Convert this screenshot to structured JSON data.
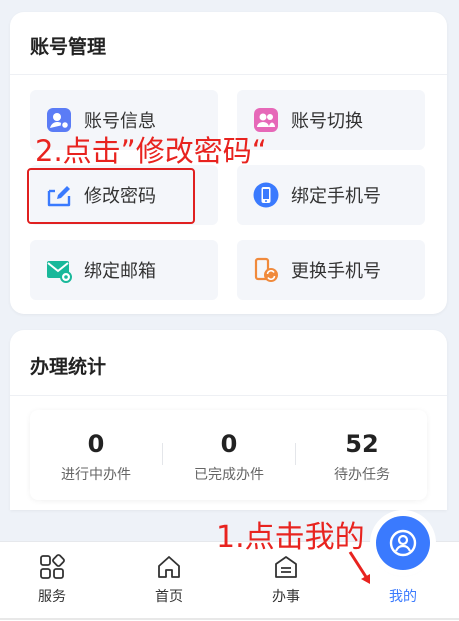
{
  "account_section": {
    "title": "账号管理",
    "items": [
      {
        "label": "账号信息",
        "icon": "user-info-icon",
        "color": "#5b7cf6"
      },
      {
        "label": "账号切换",
        "icon": "user-switch-icon",
        "color": "#e668b8"
      },
      {
        "label": "修改密码",
        "icon": "edit-password-icon",
        "color": "#3a7afe"
      },
      {
        "label": "绑定手机号",
        "icon": "bind-phone-icon",
        "color": "#3a7afe"
      },
      {
        "label": "绑定邮箱",
        "icon": "mail-icon",
        "color": "#19b89a"
      },
      {
        "label": "更换手机号",
        "icon": "change-phone-icon",
        "color": "#f08a3c"
      }
    ]
  },
  "stats_section": {
    "title": "办理统计",
    "items": [
      {
        "value": "0",
        "label": "进行中办件"
      },
      {
        "value": "0",
        "label": "已完成办件"
      },
      {
        "value": "52",
        "label": "待办任务"
      }
    ]
  },
  "tabbar": {
    "items": [
      {
        "label": "服务",
        "icon": "grid-icon"
      },
      {
        "label": "首页",
        "icon": "home-icon"
      },
      {
        "label": "办事",
        "icon": "task-icon"
      },
      {
        "label": "我的",
        "icon": "profile-icon",
        "active": true
      }
    ]
  },
  "annotations": {
    "step2": "2.点击”修改密码“",
    "step1": "1.点击我的"
  },
  "colors": {
    "accent": "#3a7afe",
    "annotation": "#e8231f"
  }
}
